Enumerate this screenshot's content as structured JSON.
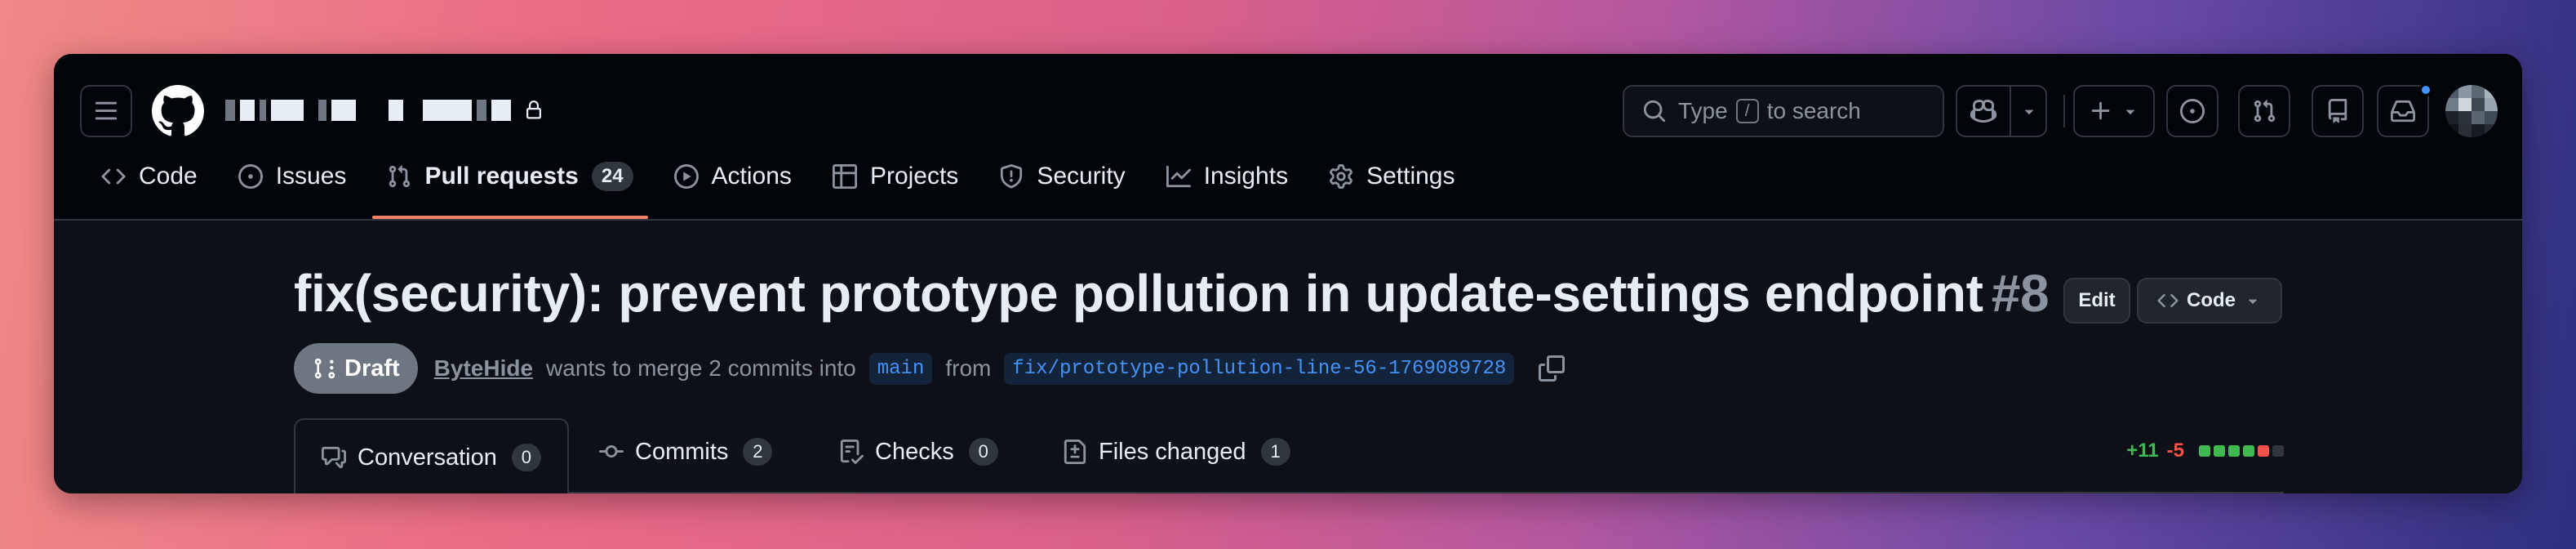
{
  "colors": {
    "accent_tab_underline": "#f78166",
    "link_blue": "#4493f8",
    "add_green": "#3fb950",
    "delete_red": "#f85149",
    "draft_gray": "#6e7681"
  },
  "header": {
    "search_placeholder_before": "Type",
    "search_key": "/",
    "search_placeholder_after": "to search"
  },
  "repo_tabs": [
    {
      "label": "Code",
      "icon": "code-icon"
    },
    {
      "label": "Issues",
      "icon": "issue-opened-icon"
    },
    {
      "label": "Pull requests",
      "icon": "git-pull-request-icon",
      "counter": "24",
      "selected": true
    },
    {
      "label": "Actions",
      "icon": "play-icon"
    },
    {
      "label": "Projects",
      "icon": "table-icon"
    },
    {
      "label": "Security",
      "icon": "shield-icon"
    },
    {
      "label": "Insights",
      "icon": "graph-icon"
    },
    {
      "label": "Settings",
      "icon": "gear-icon"
    }
  ],
  "pr": {
    "title": "fix(security): prevent prototype pollution in update-settings endpoint",
    "number": "#8",
    "edit_label": "Edit",
    "code_label": "Code",
    "status": "Draft",
    "author": "ByteHide",
    "merge_text": "wants to merge 2 commits into",
    "base_branch": "main",
    "from_text": "from",
    "head_branch": "fix/prototype-pollution-line-56-1769089728"
  },
  "pr_tabs": [
    {
      "label": "Conversation",
      "count": "0",
      "icon": "comment-discussion-icon",
      "selected": true
    },
    {
      "label": "Commits",
      "count": "2",
      "icon": "git-commit-icon"
    },
    {
      "label": "Checks",
      "count": "0",
      "icon": "checklist-icon"
    },
    {
      "label": "Files changed",
      "count": "1",
      "icon": "file-diff-icon"
    }
  ],
  "diffstat": {
    "additions": "+11",
    "deletions": "-5",
    "blocks": [
      "added",
      "added",
      "added",
      "added",
      "deleted",
      "neutral"
    ]
  }
}
